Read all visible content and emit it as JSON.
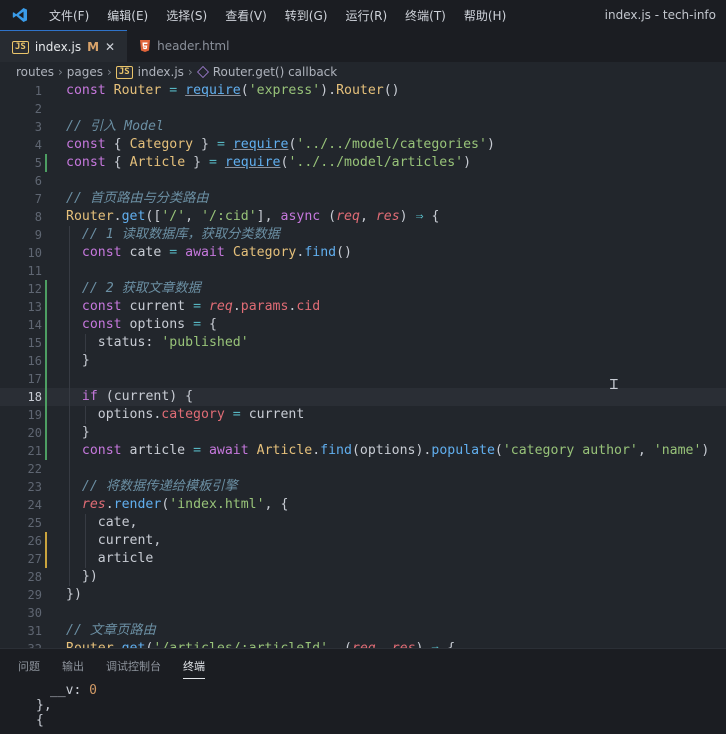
{
  "window": {
    "title": "index.js - tech-info",
    "menu": [
      "文件(F)",
      "编辑(E)",
      "选择(S)",
      "查看(V)",
      "转到(G)",
      "运行(R)",
      "终端(T)",
      "帮助(H)"
    ]
  },
  "tabs": [
    {
      "badge": "JS",
      "label": "index.js",
      "modified": "M",
      "close": "✕",
      "active": true
    },
    {
      "badge": "HTML",
      "label": "header.html",
      "active": false
    }
  ],
  "breadcrumb": {
    "items": [
      "routes",
      "pages"
    ],
    "file": "index.js",
    "symbol": "Router.get() callback",
    "separator": "›"
  },
  "editor": {
    "current_line": 18,
    "lines": [
      {
        "n": "1",
        "text": "const Router = require('express').Router()"
      },
      {
        "n": "2",
        "text": ""
      },
      {
        "n": "3",
        "text": "// 引入 Model"
      },
      {
        "n": "4",
        "text": "const { Category } = require('../../model/categories')"
      },
      {
        "n": "5",
        "text": "const { Article } = require('../../model/articles')"
      },
      {
        "n": "6",
        "text": ""
      },
      {
        "n": "7",
        "text": "// 首页路由与分类路由"
      },
      {
        "n": "8",
        "text": "Router.get(['/', '/:cid'], async (req, res) ⇒ {"
      },
      {
        "n": "9",
        "text": "  // 1 读取数据库，获取分类数据"
      },
      {
        "n": "10",
        "text": "  const cate = await Category.find()"
      },
      {
        "n": "11",
        "text": ""
      },
      {
        "n": "12",
        "text": "  // 2 获取文章数据"
      },
      {
        "n": "13",
        "text": "  const current = req.params.cid"
      },
      {
        "n": "14",
        "text": "  const options = {"
      },
      {
        "n": "15",
        "text": "    status: 'published'"
      },
      {
        "n": "16",
        "text": "  }"
      },
      {
        "n": "17",
        "text": ""
      },
      {
        "n": "18",
        "text": "  if (current) {"
      },
      {
        "n": "19",
        "text": "    options.category = current"
      },
      {
        "n": "20",
        "text": "  }"
      },
      {
        "n": "21",
        "text": "  const article = await Article.find(options).populate('category author', 'name')"
      },
      {
        "n": "22",
        "text": ""
      },
      {
        "n": "23",
        "text": "  // 将数据传递给模板引擎"
      },
      {
        "n": "24",
        "text": "  res.render('index.html', {"
      },
      {
        "n": "25",
        "text": "    cate,"
      },
      {
        "n": "26",
        "text": "    current,"
      },
      {
        "n": "27",
        "text": "    article"
      },
      {
        "n": "28",
        "text": "  })"
      },
      {
        "n": "29",
        "text": "})"
      },
      {
        "n": "30",
        "text": ""
      },
      {
        "n": "31",
        "text": "// 文章页路由"
      },
      {
        "n": "32",
        "text": "Router.get('/articles/:articleId', (req, res) ⇒ {"
      }
    ]
  },
  "panel": {
    "tabs": [
      "问题",
      "输出",
      "调试控制台",
      "终端"
    ],
    "active_tab": "终端",
    "terminal_lines": [
      "__v: 0",
      "},",
      "{"
    ]
  },
  "colors": {
    "keyword": "#c678dd",
    "type": "#e5c07b",
    "function": "#61afef",
    "string": "#98c379",
    "comment": "#6b8fa3",
    "param": "#e06c75",
    "git_added": "#4d9e62",
    "git_modified": "#c9a33d"
  }
}
